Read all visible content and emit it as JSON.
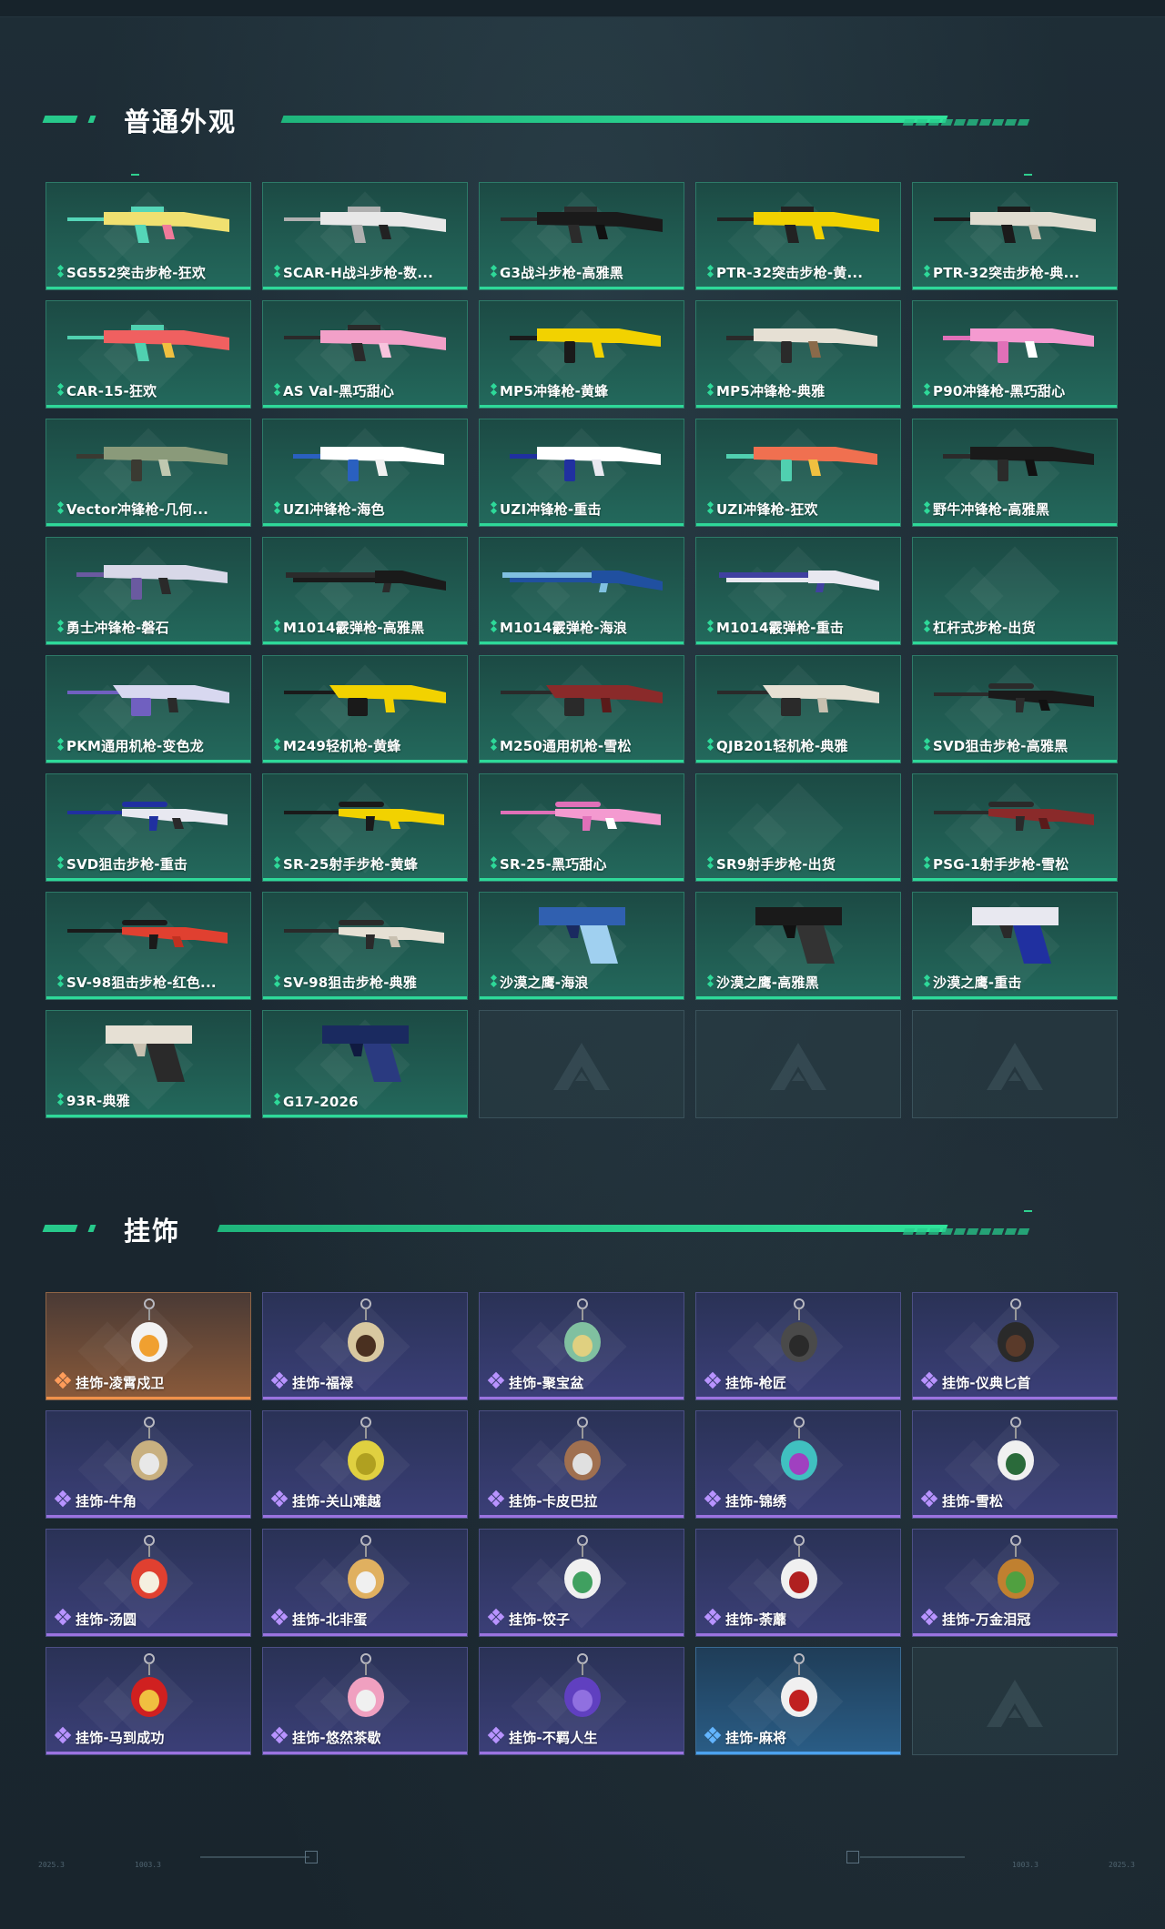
{
  "sections": {
    "skins": {
      "title": "普通外观"
    },
    "charms": {
      "title": "挂饰"
    }
  },
  "colors": {
    "accent_green": "#2ed999",
    "purple_rarity": "#9b73e0",
    "orange_rarity": "#f0914a",
    "blue_rarity": "#4ca2ee"
  },
  "skins": [
    {
      "label": "SG552突击步枪-狂欢",
      "rarity": "green",
      "icon": "rifle-icon",
      "palette": [
        "#f0e070",
        "#55d6b8",
        "#f07a9a"
      ]
    },
    {
      "label": "SCAR-H战斗步枪-数...",
      "rarity": "green",
      "icon": "rifle-icon",
      "palette": [
        "#e8e8e8",
        "#b0b0b0",
        "#222222"
      ]
    },
    {
      "label": "G3战斗步枪-高雅黑",
      "rarity": "green",
      "icon": "rifle-icon",
      "palette": [
        "#1a1a1a",
        "#2b2b2b",
        "#111111"
      ]
    },
    {
      "label": "PTR-32突击步枪-黄...",
      "rarity": "green",
      "icon": "rifle-icon",
      "palette": [
        "#f2d200",
        "#222222",
        "#f2d200"
      ]
    },
    {
      "label": "PTR-32突击步枪-典...",
      "rarity": "green",
      "icon": "rifle-icon",
      "palette": [
        "#e0dcd0",
        "#1b1b1b",
        "#c8c0b0"
      ]
    },
    {
      "label": "CAR-15-狂欢",
      "rarity": "green",
      "icon": "rifle-icon",
      "palette": [
        "#f06060",
        "#50d0b0",
        "#f0c040"
      ]
    },
    {
      "label": "AS Val-黑巧甜心",
      "rarity": "green",
      "icon": "rifle-icon",
      "palette": [
        "#f2a0c8",
        "#2a2a2a",
        "#f7c4dd"
      ]
    },
    {
      "label": "MP5冲锋枪-黄蜂",
      "rarity": "green",
      "icon": "smg-icon",
      "palette": [
        "#f2d200",
        "#1a1a1a",
        "#f2d200"
      ]
    },
    {
      "label": "MP5冲锋枪-典雅",
      "rarity": "green",
      "icon": "smg-icon",
      "palette": [
        "#e6e0d4",
        "#2a2a2a",
        "#8a6a4a"
      ]
    },
    {
      "label": "P90冲锋枪-黑巧甜心",
      "rarity": "green",
      "icon": "smg-icon",
      "palette": [
        "#f49ad0",
        "#e070b8",
        "#ffffff"
      ]
    },
    {
      "label": "Vector冲锋枪-几何...",
      "rarity": "green",
      "icon": "smg-icon",
      "palette": [
        "#8a9a7a",
        "#3a3a32",
        "#c0c8b0"
      ]
    },
    {
      "label": "UZI冲锋枪-海色",
      "rarity": "green",
      "icon": "smg-icon",
      "palette": [
        "#ffffff",
        "#2a60c0",
        "#f0f0f0"
      ]
    },
    {
      "label": "UZI冲锋枪-重击",
      "rarity": "green",
      "icon": "smg-icon",
      "palette": [
        "#ffffff",
        "#2030a0",
        "#e8e8f0"
      ]
    },
    {
      "label": "UZI冲锋枪-狂欢",
      "rarity": "green",
      "icon": "smg-icon",
      "palette": [
        "#f07050",
        "#50d0b0",
        "#f0c040"
      ]
    },
    {
      "label": "野牛冲锋枪-高雅黑",
      "rarity": "green",
      "icon": "smg-icon",
      "palette": [
        "#1a1a1a",
        "#2b2b2b",
        "#111111"
      ]
    },
    {
      "label": "勇士冲锋枪-磐石",
      "rarity": "green",
      "icon": "smg-icon",
      "palette": [
        "#d8d8e8",
        "#6a5aa0",
        "#2a2a2a"
      ]
    },
    {
      "label": "M1014霰弹枪-高雅黑",
      "rarity": "green",
      "icon": "shotgun-icon",
      "palette": [
        "#1a1a1a",
        "#2b2b2b",
        "#111111"
      ]
    },
    {
      "label": "M1014霰弹枪-海浪",
      "rarity": "green",
      "icon": "shotgun-icon",
      "palette": [
        "#2050a0",
        "#80c0e0",
        "#1a2a50"
      ]
    },
    {
      "label": "M1014霰弹枪-重击",
      "rarity": "green",
      "icon": "shotgun-icon",
      "palette": [
        "#e8e8f0",
        "#4040a0",
        "#2a2a2a"
      ]
    },
    {
      "label": "杠杆式步枪-出货",
      "rarity": "green",
      "icon": "",
      "palette": []
    },
    {
      "label": "PKM通用机枪-变色龙",
      "rarity": "green",
      "icon": "lmg-icon",
      "palette": [
        "#d8d8f0",
        "#7060c0",
        "#2a2a2a"
      ]
    },
    {
      "label": "M249轻机枪-黄蜂",
      "rarity": "green",
      "icon": "lmg-icon",
      "palette": [
        "#f2d200",
        "#1a1a1a",
        "#f2d200"
      ]
    },
    {
      "label": "M250通用机枪-雪松",
      "rarity": "green",
      "icon": "lmg-icon",
      "palette": [
        "#8a2a2a",
        "#2a2a2a",
        "#5a1a1a"
      ]
    },
    {
      "label": "QJB201轻机枪-典雅",
      "rarity": "green",
      "icon": "lmg-icon",
      "palette": [
        "#e6e0d4",
        "#2a2a2a",
        "#c8c0b0"
      ]
    },
    {
      "label": "SVD狙击步枪-高雅黑",
      "rarity": "green",
      "icon": "sniper-icon",
      "palette": [
        "#1a1a1a",
        "#2b2b2b",
        "#111111"
      ]
    },
    {
      "label": "SVD狙击步枪-重击",
      "rarity": "green",
      "icon": "sniper-icon",
      "palette": [
        "#e8e8f0",
        "#2030a0",
        "#2a2a2a"
      ]
    },
    {
      "label": "SR-25射手步枪-黄蜂",
      "rarity": "green",
      "icon": "sniper-icon",
      "palette": [
        "#f2d200",
        "#1a1a1a",
        "#f2d200"
      ]
    },
    {
      "label": "SR-25-黑巧甜心",
      "rarity": "green",
      "icon": "sniper-icon",
      "palette": [
        "#f49ad0",
        "#e070b8",
        "#ffffff"
      ]
    },
    {
      "label": "SR9射手步枪-出货",
      "rarity": "green",
      "icon": "",
      "palette": []
    },
    {
      "label": "PSG-1射手步枪-雪松",
      "rarity": "green",
      "icon": "sniper-icon",
      "palette": [
        "#8a2a2a",
        "#2a2a2a",
        "#5a1a1a"
      ]
    },
    {
      "label": "SV-98狙击步枪-红色...",
      "rarity": "green",
      "icon": "sniper-icon",
      "palette": [
        "#e04030",
        "#1a1a1a",
        "#c03020"
      ]
    },
    {
      "label": "SV-98狙击步枪-典雅",
      "rarity": "green",
      "icon": "sniper-icon",
      "palette": [
        "#e6e0d4",
        "#2a2a2a",
        "#c8c0b0"
      ]
    },
    {
      "label": "沙漠之鹰-海浪",
      "rarity": "green",
      "icon": "pistol-icon",
      "palette": [
        "#3060b0",
        "#a0d0f0",
        "#1a2a60"
      ]
    },
    {
      "label": "沙漠之鹰-高雅黑",
      "rarity": "green",
      "icon": "pistol-icon",
      "palette": [
        "#1a1a1a",
        "#333333",
        "#111111"
      ]
    },
    {
      "label": "沙漠之鹰-重击",
      "rarity": "green",
      "icon": "pistol-icon",
      "palette": [
        "#e8e8f0",
        "#2030a0",
        "#2a2a2a"
      ]
    },
    {
      "label": "93R-典雅",
      "rarity": "green",
      "icon": "pistol-icon",
      "palette": [
        "#e6e0d4",
        "#2a2a2a",
        "#c8c0b0"
      ]
    },
    {
      "label": "G17-2026",
      "rarity": "green",
      "icon": "pistol-icon",
      "palette": [
        "#1a2a60",
        "#2a3a80",
        "#101a40"
      ]
    },
    {
      "label": "",
      "rarity": "empty",
      "icon": "",
      "palette": []
    },
    {
      "label": "",
      "rarity": "empty",
      "icon": "",
      "palette": []
    },
    {
      "label": "",
      "rarity": "empty",
      "icon": "",
      "palette": []
    }
  ],
  "charms": [
    {
      "label": "挂饰-凌霄戍卫",
      "rarity": "orange",
      "icon": "eagle-charm-icon",
      "palette": [
        "#f2f2f2",
        "#f0a030"
      ]
    },
    {
      "label": "挂饰-福禄",
      "rarity": "purple",
      "icon": "gourd-charm-icon",
      "palette": [
        "#d8c8a0",
        "#4a3020"
      ]
    },
    {
      "label": "挂饰-聚宝盆",
      "rarity": "purple",
      "icon": "treasure-bowl-charm-icon",
      "palette": [
        "#80c0a0",
        "#e0d080"
      ]
    },
    {
      "label": "挂饰-枪匠",
      "rarity": "purple",
      "icon": "vest-charm-icon",
      "palette": [
        "#4a4a4a",
        "#2a2a2a"
      ]
    },
    {
      "label": "挂饰-仪典匕首",
      "rarity": "purple",
      "icon": "dagger-charm-icon",
      "palette": [
        "#2a2a2a",
        "#5a3a2a"
      ]
    },
    {
      "label": "挂饰-牛角",
      "rarity": "purple",
      "icon": "horns-charm-icon",
      "palette": [
        "#c8b080",
        "#e8e8e8"
      ]
    },
    {
      "label": "挂饰-关山难越",
      "rarity": "purple",
      "icon": "scroll-charm-icon",
      "palette": [
        "#e0d040",
        "#b0a020"
      ]
    },
    {
      "label": "挂饰-卡皮巴拉",
      "rarity": "purple",
      "icon": "capybara-charm-icon",
      "palette": [
        "#a07050",
        "#e0e0e0"
      ]
    },
    {
      "label": "挂饰-锦绣",
      "rarity": "purple",
      "icon": "butterfly-charm-icon",
      "palette": [
        "#40c0c0",
        "#a040c0"
      ]
    },
    {
      "label": "挂饰-雪松",
      "rarity": "purple",
      "icon": "tree-charm-icon",
      "palette": [
        "#f0f0f0",
        "#2a6a3a"
      ]
    },
    {
      "label": "挂饰-汤圆",
      "rarity": "purple",
      "icon": "tangyuan-charm-icon",
      "palette": [
        "#e04030",
        "#f5f0e0"
      ]
    },
    {
      "label": "挂饰-北非蛋",
      "rarity": "purple",
      "icon": "shakshuka-charm-icon",
      "palette": [
        "#e0b060",
        "#f0f0f0"
      ]
    },
    {
      "label": "挂饰-饺子",
      "rarity": "purple",
      "icon": "dumpling-charm-icon",
      "palette": [
        "#f0f0f0",
        "#40a060"
      ]
    },
    {
      "label": "挂饰-荼蘼",
      "rarity": "purple",
      "icon": "flower-charm-icon",
      "palette": [
        "#f0f0f0",
        "#b02020"
      ]
    },
    {
      "label": "挂饰-万金泪冠",
      "rarity": "purple",
      "icon": "burger-charm-icon",
      "palette": [
        "#c08030",
        "#50a040"
      ]
    },
    {
      "label": "挂饰-马到成功",
      "rarity": "purple",
      "icon": "horse-charm-icon",
      "palette": [
        "#d02020",
        "#f0c040"
      ]
    },
    {
      "label": "挂饰-悠然茶歇",
      "rarity": "purple",
      "icon": "cupcake-charm-icon",
      "palette": [
        "#f0a0c0",
        "#f0f0f0"
      ]
    },
    {
      "label": "挂饰-不羁人生",
      "rarity": "purple",
      "icon": "sneaker-charm-icon",
      "palette": [
        "#6040c0",
        "#9070e0"
      ]
    },
    {
      "label": "挂饰-麻将",
      "rarity": "blue",
      "icon": "mahjong-charm-icon",
      "palette": [
        "#f0f0f0",
        "#c02020"
      ]
    },
    {
      "label": "",
      "rarity": "empty",
      "icon": "",
      "palette": []
    }
  ],
  "footer": {
    "left_a": "2025.3",
    "left_b": "1003.3",
    "right_a": "1003.3",
    "right_b": "2025.3"
  }
}
